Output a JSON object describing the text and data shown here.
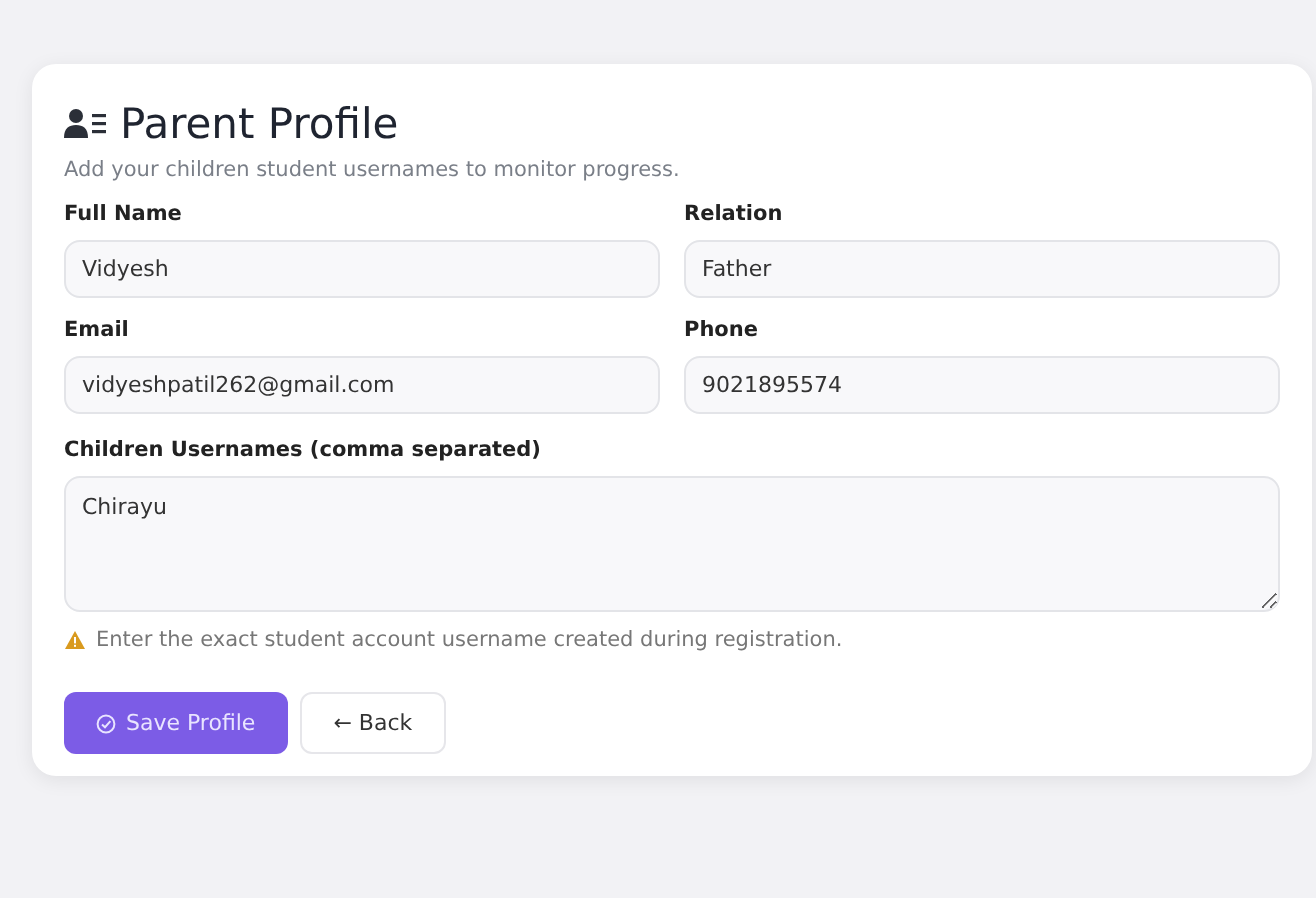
{
  "card": {
    "title": "Parent Profile",
    "subtitle": "Add your children student usernames to monitor progress."
  },
  "fields": [
    {
      "label": "Full Name",
      "value": "Vidyesh"
    },
    {
      "label": "Relation",
      "value": "Father"
    },
    {
      "label": "Email",
      "value": "vidyeshpatil262@gmail.com"
    },
    {
      "label": "Phone",
      "value": "9021895574"
    }
  ],
  "children_field": {
    "label": "Children Usernames (comma separated)",
    "value": "Chirayu"
  },
  "hint": "Enter the exact student account username created during registration.",
  "buttons": [
    {
      "label": "Save Profile",
      "kind": "primary"
    },
    {
      "label": "← Back",
      "kind": "secondary"
    }
  ]
}
